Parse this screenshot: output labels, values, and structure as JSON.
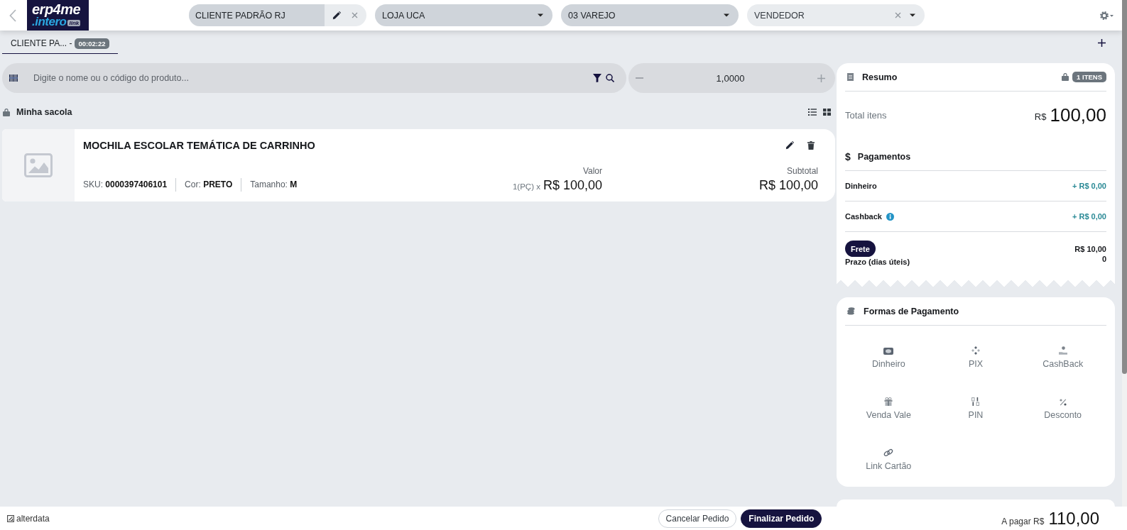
{
  "header": {
    "logo": {
      "name": "erp4me",
      "product": ".intero",
      "tag": "link"
    },
    "selectors": [
      {
        "kind": "client",
        "value": "CLIENTE PADRÃO RJ",
        "clearable": true
      },
      {
        "kind": "dropdown",
        "value": "LOJA UCA",
        "clearable": false
      },
      {
        "kind": "dropdown",
        "value": "03 VAREJO",
        "clearable": false
      },
      {
        "kind": "dropdown",
        "placeholder": "VENDEDOR",
        "clearable": true
      }
    ]
  },
  "tabs": [
    {
      "label": "CLIENTE PA... -",
      "timer": "00:02:22",
      "selected": true
    }
  ],
  "search": {
    "placeholder": "Digite o nome ou o código do produto..."
  },
  "quantity": {
    "value": "1,0000"
  },
  "bag": {
    "title": "Minha sacola",
    "items": [
      {
        "name": "MOCHILA ESCOLAR TEMÁTICA DE CARRINHO",
        "attributes": [
          "SKU: **0000397406101**",
          "Cor: **PRETO**",
          "Tamanho: **M**"
        ],
        "value_label": "Valor",
        "quantity": "1(PÇ) x",
        "price": "R$ 100,00",
        "subtotal_label": "Subtotal",
        "subtotal": "R$ 100,00"
      }
    ]
  },
  "summary": {
    "title": "Resumo",
    "badge": "1 ITENS",
    "total_label": "Total itens",
    "currency": "R$",
    "total": "100,00",
    "payments_symbol": "$",
    "payments_title": "Pagamentos",
    "payments": [
      {
        "label": "Dinheiro",
        "info": false,
        "amount": "+ R$ 0,00"
      },
      {
        "label": "Cashback",
        "info": true,
        "amount": "+ R$ 0,00"
      }
    ],
    "shipping": {
      "button": "Frete",
      "amount": "R$ 10,00",
      "term_label": "Prazo (dias úteis)",
      "term": "0"
    }
  },
  "payment_methods": {
    "title": "Formas de Pagamento",
    "methods": [
      {
        "kind": "cash",
        "label": "Dinheiro"
      },
      {
        "kind": "pix",
        "label": "PIX"
      },
      {
        "kind": "cashback",
        "label": "CashBack"
      },
      {
        "kind": "voucher",
        "label": "Venda Vale"
      },
      {
        "kind": "pin",
        "label": "PIN"
      },
      {
        "kind": "discount",
        "label": "Desconto"
      },
      {
        "kind": "link",
        "label": "Link Cartão"
      }
    ]
  },
  "footer": {
    "brand": "alterdata",
    "buttons": [
      {
        "kind": "secondary",
        "label": "Cancelar Pedido"
      },
      {
        "kind": "primary",
        "label": "Finalizar Pedido"
      }
    ],
    "due_label": "A pagar R$",
    "due": "110,00"
  }
}
